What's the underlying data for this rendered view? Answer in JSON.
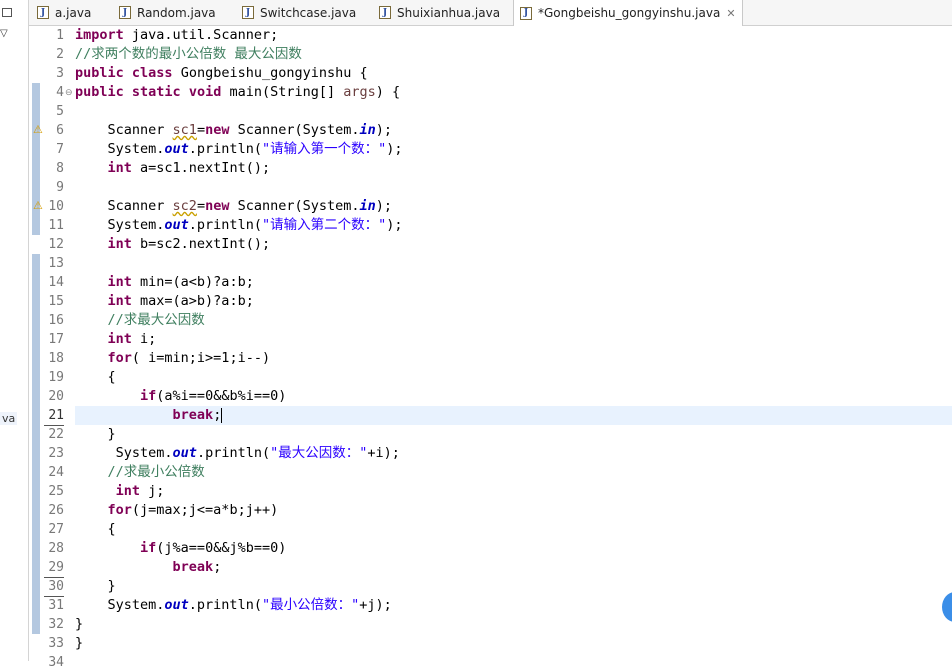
{
  "tabs": [
    {
      "label": "a.java",
      "icon": "java-file-icon",
      "active": false
    },
    {
      "label": "Random.java",
      "icon": "java-file-icon",
      "active": false
    },
    {
      "label": "Switchcase.java",
      "icon": "java-file-icon",
      "active": false
    },
    {
      "label": "Shuixianhua.java",
      "icon": "java-file-icon",
      "active": false
    },
    {
      "label": "*Gongbeishu_gongyinshu.java",
      "icon": "java-file-icon",
      "active": true,
      "close": "✕"
    }
  ],
  "left_panel": {
    "java_label": "va"
  },
  "editor": {
    "line_numbers": [
      "1",
      "2",
      "3",
      "4",
      "5",
      "6",
      "7",
      "8",
      "9",
      "10",
      "11",
      "12",
      "13",
      "14",
      "15",
      "16",
      "17",
      "18",
      "19",
      "20",
      "21",
      "22",
      "23",
      "24",
      "25",
      "26",
      "27",
      "28",
      "29",
      "30",
      "31",
      "32",
      "33",
      "34"
    ],
    "code": {
      "l1_kw": "import",
      "l1_rest": " java.util.Scanner;",
      "l2_cm": "//求两个数的最小公倍数 最大公因数",
      "l3_kw1": "public",
      "l3_kw2": "class",
      "l3_rest": " Gongbeishu_gongyinshu {",
      "l4_kw1": "public",
      "l4_kw2": "static",
      "l4_kw3": "void",
      "l4_a": " main(String[] ",
      "l4_var": "args",
      "l4_b": ") {",
      "l6_a": "    Scanner ",
      "l6_var": "sc1",
      "l6_eq": "=",
      "l6_kw": "new",
      "l6_b": " Scanner(System.",
      "l6_fd": "in",
      "l6_c": ");",
      "l7_a": "    System.",
      "l7_fd": "out",
      "l7_b": ".println(",
      "l7_st": "\"请输入第一个数：\"",
      "l7_c": ");",
      "l8_kw": "int",
      "l8_rest": " a=sc1.nextInt();",
      "l10_a": "    Scanner ",
      "l10_var": "sc2",
      "l10_eq": "=",
      "l10_kw": "new",
      "l10_b": " Scanner(System.",
      "l10_fd": "in",
      "l10_c": ");",
      "l11_a": "    System.",
      "l11_fd": "out",
      "l11_b": ".println(",
      "l11_st": "\"请输入第二个数：\"",
      "l11_c": ");",
      "l12_kw": "int",
      "l12_rest": " b=sc2.nextInt();",
      "l14_kw": "int",
      "l14_rest": " min=(a<b)?a:b;",
      "l15_kw": "int",
      "l15_rest": " max=(a>b)?a:b;",
      "l16_cm": "//求最大公因数",
      "l17_kw": "int",
      "l17_rest": " i;",
      "l18_kw": "for",
      "l18_rest": "( i=min;i>=1;i--)",
      "l19": "    {",
      "l20_kw": "if",
      "l20_rest": "(a%i==0&&b%i==0)",
      "l21_kw": "break",
      "l21_rest": ";",
      "l22": "    }",
      "l23_a": "     System.",
      "l23_fd": "out",
      "l23_b": ".println(",
      "l23_st": "\"最大公因数：\"",
      "l23_c": "+i);",
      "l24_cm": "//求最小公倍数",
      "l25_kw": "int",
      "l25_rest": " j;",
      "l26_kw": "for",
      "l26_rest": "(j=max;j<=a*b;j++)",
      "l27": "    {",
      "l28_kw": "if",
      "l28_rest": "(j%a==0&&j%b==0)",
      "l29_kw": "break",
      "l29_rest": ";",
      "l30": "    }",
      "l31_a": "    System.",
      "l31_fd": "out",
      "l31_b": ".println(",
      "l31_st": "\"最小公倍数：\"",
      "l31_c": "+j);",
      "l32": "}",
      "l33": "}"
    }
  },
  "colors": {
    "keyword": "#7f0055",
    "comment": "#3f7f5f",
    "string": "#2a00ff",
    "field": "#0000c0",
    "current_line": "#e8f2fe"
  }
}
